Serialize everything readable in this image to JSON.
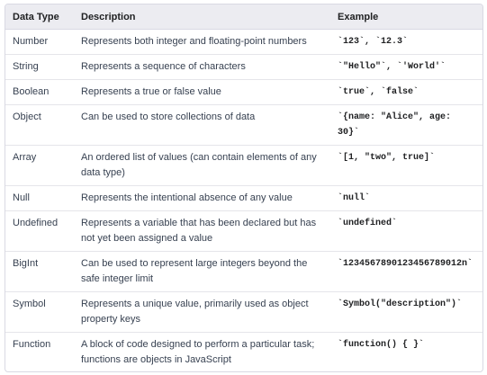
{
  "table": {
    "headers": [
      "Data Type",
      "Description",
      "Example"
    ],
    "rows": [
      {
        "type": "Number",
        "description": "Represents both integer and floating-point numbers",
        "example": "`123`, `12.3`"
      },
      {
        "type": "String",
        "description": "Represents a sequence of characters",
        "example": "`\"Hello\"`, `'World'`"
      },
      {
        "type": "Boolean",
        "description": "Represents a true or false value",
        "example": "`true`, `false`"
      },
      {
        "type": "Object",
        "description": "Can be used to store collections of data",
        "example": "`{name: \"Alice\", age: 30}`"
      },
      {
        "type": "Array",
        "description": "An ordered list of values (can contain elements of any data type)",
        "example": "`[1, \"two\", true]`"
      },
      {
        "type": "Null",
        "description": "Represents the intentional absence of any value",
        "example": "`null`"
      },
      {
        "type": "Undefined",
        "description": "Represents a variable that has been declared but has not yet been assigned a value",
        "example": "`undefined`"
      },
      {
        "type": "BigInt",
        "description": "Can be used to represent large integers beyond the safe integer limit",
        "example": "`1234567890123456789012n`"
      },
      {
        "type": "Symbol",
        "description": "Represents a unique value, primarily used as object property keys",
        "example": "`Symbol(\"description\")`"
      },
      {
        "type": "Function",
        "description": "A block of code designed to perform a particular task; functions are objects in JavaScript",
        "example": "`function() { }`"
      }
    ]
  }
}
